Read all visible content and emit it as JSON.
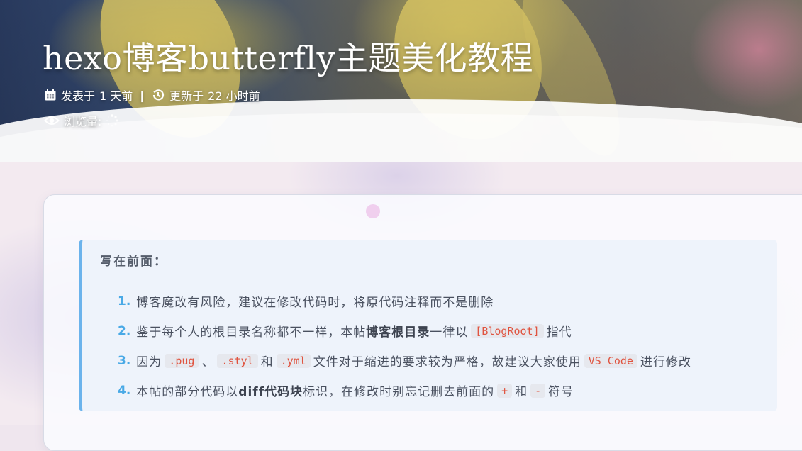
{
  "post": {
    "title": "hexo博客butterfly主题美化教程",
    "meta": {
      "published_label": "发表于",
      "published_value": "1 天前",
      "separator": "|",
      "updated_label": "更新于",
      "updated_value": "22 小时前",
      "views_label": "浏览量:"
    }
  },
  "note": {
    "heading": "写在前面：",
    "items": [
      {
        "num": "1.",
        "text": "博客魔改有风险，建议在修改代码时，将原代码注释而不是删除"
      },
      {
        "num": "2.",
        "t1": "鉴于每个人的根目录名称都不一样，本帖",
        "b1": "博客根目录",
        "t2": "一律以",
        "c1": "[BlogRoot]",
        "t3": "指代"
      },
      {
        "num": "3.",
        "t1": "因为",
        "c1": ".pug",
        "t2": "、",
        "c2": ".styl",
        "t3": "和",
        "c3": ".yml",
        "t4": "文件对于缩进的要求较为严格，故建议大家使用",
        "c4": "VS Code",
        "t5": "进行修改"
      },
      {
        "num": "4.",
        "t1": "本帖的部分代码以",
        "b1": "diff代码块",
        "t2": "标识，在修改时别忘记删去前面的",
        "c1": "+",
        "t3": "和",
        "c2": "-",
        "t4": "符号"
      }
    ]
  },
  "colors": {
    "accent": "#49a9e6",
    "note_border": "#6bb3ec",
    "code_text": "#e0533f"
  },
  "icons": [
    "calendar-icon",
    "history-icon",
    "eye-icon",
    "loading-spinner-icon"
  ]
}
